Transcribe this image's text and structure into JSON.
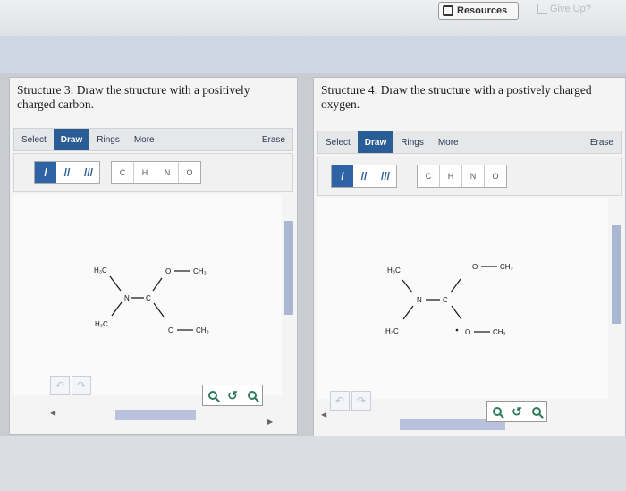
{
  "topbar": {
    "resources_label": "Resources",
    "giveup_label": "Give Up?"
  },
  "panels": [
    {
      "title": "Structure 3: Draw the structure with a positively charged carbon.",
      "toolbar": {
        "select": "Select",
        "draw": "Draw",
        "rings": "Rings",
        "more": "More",
        "erase": "Erase"
      },
      "bonds": [
        "/",
        "//",
        "///"
      ],
      "atoms": [
        "C",
        "H",
        "N",
        "O"
      ],
      "molecule": {
        "ch3_top_left": "H₃C",
        "ch3_bottom_left": "H₃C",
        "n": "N",
        "c": "C",
        "o_top": "O",
        "o_bottom": "O",
        "ch3_top_right": "CH₃",
        "ch3_bottom_right": "CH₃"
      }
    },
    {
      "title": "Structure 4: Draw the structure with a postively charged oxygen.",
      "toolbar": {
        "select": "Select",
        "draw": "Draw",
        "rings": "Rings",
        "more": "More",
        "erase": "Erase"
      },
      "bonds": [
        "/",
        "//",
        "///"
      ],
      "atoms": [
        "C",
        "H",
        "N",
        "O"
      ],
      "molecule": {
        "ch3_top_left": "H₃C",
        "ch3_bottom_left": "H₃C",
        "n": "N",
        "c": "C",
        "o_top": "O",
        "o_bottom": "O",
        "ch3_top_right": "CH₃",
        "ch3_bottom_right": "CH₃"
      }
    }
  ],
  "icons": {
    "undo": "undo-icon",
    "redo": "redo-icon",
    "zoom_in": "zoom-in-icon",
    "zoom_reset": "zoom-reset-icon",
    "zoom_out": "zoom-out-icon"
  }
}
